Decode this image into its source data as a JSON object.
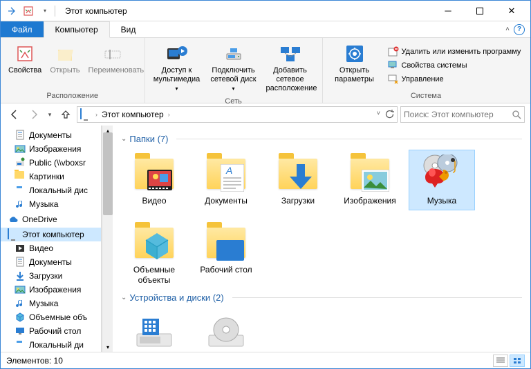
{
  "title": "Этот компьютер",
  "tabs": {
    "file": "Файл",
    "computer": "Компьютер",
    "view": "Вид"
  },
  "ribbon": {
    "g1": {
      "label": "Расположение",
      "properties": "Свойства",
      "open": "Открыть",
      "rename": "Переименовать"
    },
    "g2": {
      "label": "Сеть",
      "media": "Доступ к мультимедиа",
      "mapdrive": "Подключить сетевой диск",
      "addnet": "Добавить сетевое расположение"
    },
    "g3": {
      "label": "Система",
      "settings": "Открыть параметры",
      "uninstall": "Удалить или изменить программу",
      "sysprops": "Свойства системы",
      "manage": "Управление"
    }
  },
  "addr": {
    "crumb": "Этот компьютер",
    "search_placeholder": "Поиск: Этот компьютер"
  },
  "tree": {
    "items": [
      {
        "label": "Документы",
        "lvl": 1
      },
      {
        "label": "Изображения",
        "lvl": 1
      },
      {
        "label": "Public (\\\\vboxsr",
        "lvl": 1
      },
      {
        "label": "Картинки",
        "lvl": 1
      },
      {
        "label": "Локальный дис",
        "lvl": 1
      },
      {
        "label": "Музыка",
        "lvl": 1
      },
      {
        "label": "OneDrive",
        "lvl": 0
      },
      {
        "label": "Этот компьютер",
        "lvl": 0,
        "selected": true
      },
      {
        "label": "Видео",
        "lvl": 1
      },
      {
        "label": "Документы",
        "lvl": 1
      },
      {
        "label": "Загрузки",
        "lvl": 1
      },
      {
        "label": "Изображения",
        "lvl": 1
      },
      {
        "label": "Музыка",
        "lvl": 1
      },
      {
        "label": "Объемные объ",
        "lvl": 1
      },
      {
        "label": "Рабочий стол",
        "lvl": 1
      },
      {
        "label": "Локальный ди",
        "lvl": 1
      }
    ]
  },
  "content": {
    "groups": [
      {
        "header": "Папки (7)",
        "items": [
          {
            "label": "Видео"
          },
          {
            "label": "Документы"
          },
          {
            "label": "Загрузки"
          },
          {
            "label": "Изображения"
          },
          {
            "label": "Музыка",
            "selected": true
          },
          {
            "label": "Объемные объекты"
          },
          {
            "label": "Рабочий стол"
          }
        ]
      },
      {
        "header": "Устройства и диски (2)",
        "items": []
      }
    ]
  },
  "status": {
    "count": "Элементов: 10"
  }
}
